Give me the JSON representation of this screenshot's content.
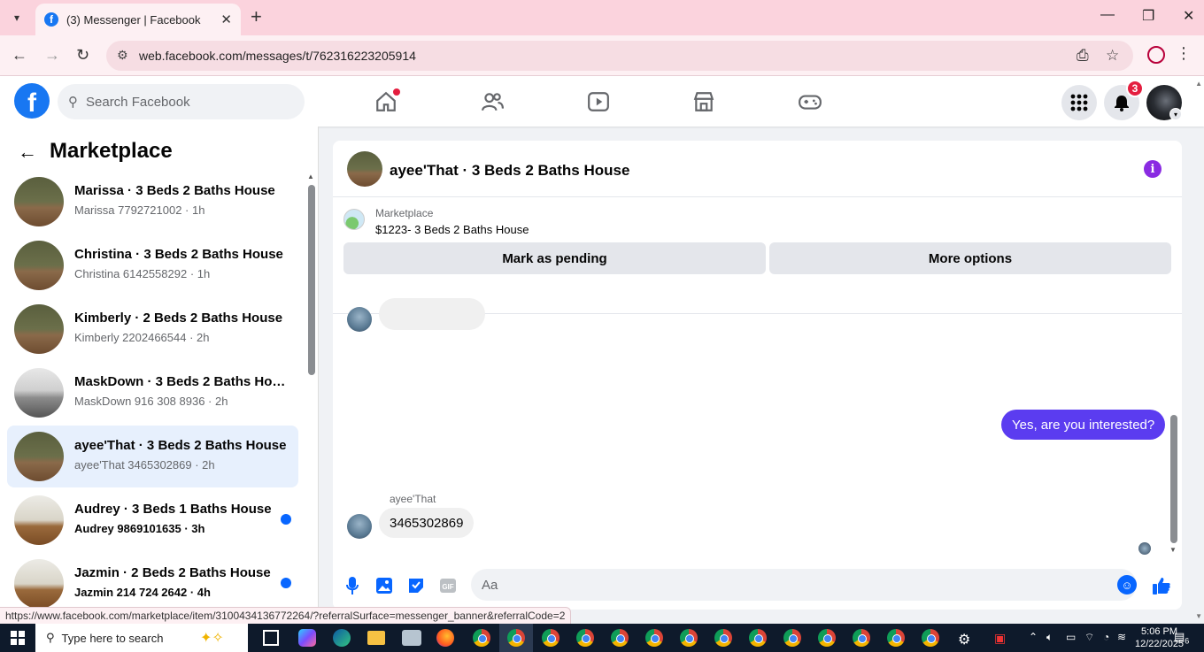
{
  "browser": {
    "tab_title": "(3) Messenger | Facebook",
    "url": "web.facebook.com/messages/t/762316223205914",
    "status_url": "https://www.facebook.com/marketplace/item/3100434136772264/?referralSurface=messenger_banner&referralCode=2"
  },
  "fb_header": {
    "search_placeholder": "Search Facebook",
    "notification_count": "3"
  },
  "left_panel": {
    "title": "Marketplace",
    "conversations": [
      {
        "name": "Marissa · 3 Beds 2 Baths House",
        "sub": "Marissa 7792721002 · 1h",
        "unread": false,
        "active": false,
        "thumb": "room1"
      },
      {
        "name": "Christina · 3 Beds 2 Baths House",
        "sub": "Christina 6142558292 · 1h",
        "unread": false,
        "active": false,
        "thumb": "room1"
      },
      {
        "name": "Kimberly · 2 Beds 2 Baths House",
        "sub": "Kimberly 2202466544 · 2h",
        "unread": false,
        "active": false,
        "thumb": "room1"
      },
      {
        "name": "MaskDown · 3 Beds 2 Baths Hou...",
        "sub": "MaskDown 916 308 8936 · 2h",
        "unread": false,
        "active": false,
        "thumb": "room2"
      },
      {
        "name": "ayee'That · 3 Beds 2 Baths House",
        "sub": "ayee'That 3465302869 · 2h",
        "unread": false,
        "active": true,
        "thumb": "room1"
      },
      {
        "name": "Audrey · 3 Beds 1 Baths House",
        "sub": "Audrey 9869101635 · 3h",
        "unread": true,
        "active": false,
        "thumb": "room3"
      },
      {
        "name": "Jazmin · 2 Beds 2 Baths House",
        "sub": "Jazmin 214 724 2642 · 4h",
        "unread": true,
        "active": false,
        "thumb": "room3"
      }
    ]
  },
  "chat": {
    "title": "ayee'That · 3 Beds 2 Baths House",
    "banner_label": "Marketplace",
    "banner_price": "$1223- 3 Beds 2 Baths House",
    "btn_pending": "Mark as pending",
    "btn_more": "More options",
    "msg_out": "Yes, are you interested?",
    "sender_name": "ayee'That",
    "msg_in": "3465302869",
    "composer_placeholder": "Aa"
  },
  "taskbar": {
    "search_placeholder": "Type here to search",
    "time": "5:06 PM",
    "date": "12/22/2025",
    "notif": "6"
  },
  "colors": {
    "fb_blue": "#1877f2",
    "outgoing_bubble": "#5b3cf0",
    "active_row": "#e7f0fd"
  }
}
